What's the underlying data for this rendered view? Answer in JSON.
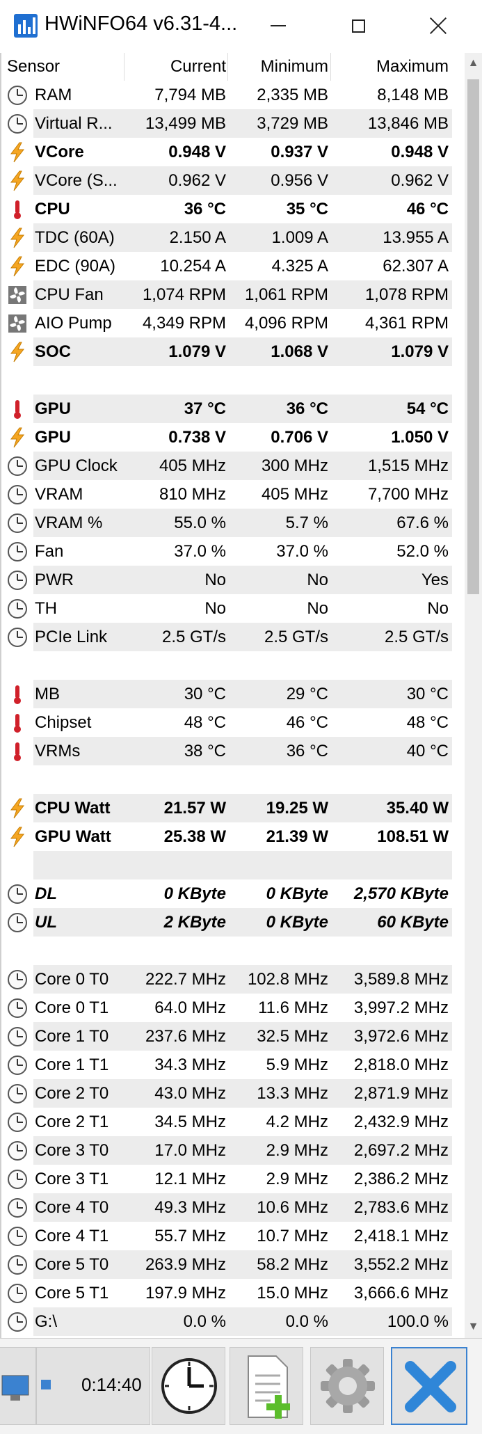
{
  "window": {
    "title": "HWiNFO64 v6.31-4..."
  },
  "table": {
    "columns": [
      "Sensor",
      "Current",
      "Minimum",
      "Maximum"
    ],
    "rows": [
      {
        "name": "RAM",
        "icon": "clock-icon",
        "style": "",
        "current": "7,794 MB",
        "minimum": "2,335 MB",
        "maximum": "8,148 MB"
      },
      {
        "name": "Virtual R...",
        "icon": "clock-icon",
        "style": "",
        "current": "13,499 MB",
        "minimum": "3,729 MB",
        "maximum": "13,846 MB"
      },
      {
        "name": "VCore",
        "icon": "lightning-icon",
        "style": "b",
        "current": "0.948 V",
        "minimum": "0.937 V",
        "maximum": "0.948 V"
      },
      {
        "name": "VCore (S...",
        "icon": "lightning-icon",
        "style": "",
        "current": "0.962 V",
        "minimum": "0.956 V",
        "maximum": "0.962 V"
      },
      {
        "name": "CPU",
        "icon": "thermometer-icon",
        "style": "b",
        "current": "36 °C",
        "minimum": "35 °C",
        "maximum": "46 °C"
      },
      {
        "name": "TDC (60A)",
        "icon": "lightning-icon",
        "style": "",
        "current": "2.150 A",
        "minimum": "1.009 A",
        "maximum": "13.955 A"
      },
      {
        "name": "EDC (90A)",
        "icon": "lightning-icon",
        "style": "",
        "current": "10.254 A",
        "minimum": "4.325 A",
        "maximum": "62.307 A"
      },
      {
        "name": "CPU Fan",
        "icon": "fan-icon",
        "style": "",
        "current": "1,074 RPM",
        "minimum": "1,061 RPM",
        "maximum": "1,078 RPM"
      },
      {
        "name": "AIO Pump",
        "icon": "fan-icon",
        "style": "",
        "current": "4,349 RPM",
        "minimum": "4,096 RPM",
        "maximum": "4,361 RPM"
      },
      {
        "name": "SOC",
        "icon": "lightning-icon",
        "style": "b",
        "current": "1.079 V",
        "minimum": "1.068 V",
        "maximum": "1.079 V"
      },
      {
        "name": "",
        "icon": "",
        "style": "",
        "current": "",
        "minimum": "",
        "maximum": ""
      },
      {
        "name": "GPU",
        "icon": "thermometer-icon",
        "style": "b",
        "current": "37 °C",
        "minimum": "36 °C",
        "maximum": "54 °C"
      },
      {
        "name": "GPU",
        "icon": "lightning-icon",
        "style": "b",
        "current": "0.738 V",
        "minimum": "0.706 V",
        "maximum": "1.050 V"
      },
      {
        "name": "GPU Clock",
        "icon": "clock-icon",
        "style": "",
        "current": "405 MHz",
        "minimum": "300 MHz",
        "maximum": "1,515 MHz"
      },
      {
        "name": "VRAM",
        "icon": "clock-icon",
        "style": "",
        "current": "810 MHz",
        "minimum": "405 MHz",
        "maximum": "7,700 MHz"
      },
      {
        "name": "VRAM %",
        "icon": "clock-icon",
        "style": "",
        "current": "55.0 %",
        "minimum": "5.7 %",
        "maximum": "67.6 %"
      },
      {
        "name": "Fan",
        "icon": "clock-icon",
        "style": "",
        "current": "37.0 %",
        "minimum": "37.0 %",
        "maximum": "52.0 %"
      },
      {
        "name": "PWR",
        "icon": "clock-icon",
        "style": "",
        "current": "No",
        "minimum": "No",
        "maximum": "Yes"
      },
      {
        "name": "TH",
        "icon": "clock-icon",
        "style": "",
        "current": "No",
        "minimum": "No",
        "maximum": "No"
      },
      {
        "name": "PCIe Link",
        "icon": "clock-icon",
        "style": "",
        "current": "2.5 GT/s",
        "minimum": "2.5 GT/s",
        "maximum": "2.5 GT/s"
      },
      {
        "name": "",
        "icon": "",
        "style": "",
        "current": "",
        "minimum": "",
        "maximum": ""
      },
      {
        "name": "MB",
        "icon": "thermometer-icon",
        "style": "",
        "current": "30 °C",
        "minimum": "29 °C",
        "maximum": "30 °C"
      },
      {
        "name": "Chipset",
        "icon": "thermometer-icon",
        "style": "",
        "current": "48 °C",
        "minimum": "46 °C",
        "maximum": "48 °C"
      },
      {
        "name": "VRMs",
        "icon": "thermometer-icon",
        "style": "",
        "current": "38 °C",
        "minimum": "36 °C",
        "maximum": "40 °C"
      },
      {
        "name": "",
        "icon": "",
        "style": "",
        "current": "",
        "minimum": "",
        "maximum": ""
      },
      {
        "name": "CPU Watt",
        "icon": "lightning-icon",
        "style": "b",
        "current": "21.57 W",
        "minimum": "19.25 W",
        "maximum": "35.40 W"
      },
      {
        "name": "GPU Watt",
        "icon": "lightning-icon",
        "style": "b",
        "current": "25.38 W",
        "minimum": "21.39 W",
        "maximum": "108.51 W"
      },
      {
        "name": "",
        "icon": "",
        "style": "",
        "current": "",
        "minimum": "",
        "maximum": ""
      },
      {
        "name": "DL",
        "icon": "clock-icon",
        "style": "bi",
        "current": "0 KByte",
        "minimum": "0 KByte",
        "maximum": "2,570 KByte"
      },
      {
        "name": "UL",
        "icon": "clock-icon",
        "style": "bi",
        "current": "2 KByte",
        "minimum": "0 KByte",
        "maximum": "60 KByte"
      },
      {
        "name": "",
        "icon": "",
        "style": "",
        "current": "",
        "minimum": "",
        "maximum": ""
      },
      {
        "name": "Core 0 T0",
        "icon": "clock-icon",
        "style": "",
        "current": "222.7 MHz",
        "minimum": "102.8 MHz",
        "maximum": "3,589.8 MHz"
      },
      {
        "name": "Core 0 T1",
        "icon": "clock-icon",
        "style": "",
        "current": "64.0 MHz",
        "minimum": "11.6 MHz",
        "maximum": "3,997.2 MHz"
      },
      {
        "name": "Core 1 T0",
        "icon": "clock-icon",
        "style": "",
        "current": "237.6 MHz",
        "minimum": "32.5 MHz",
        "maximum": "3,972.6 MHz"
      },
      {
        "name": "Core 1 T1",
        "icon": "clock-icon",
        "style": "",
        "current": "34.3 MHz",
        "minimum": "5.9 MHz",
        "maximum": "2,818.0 MHz"
      },
      {
        "name": "Core 2 T0",
        "icon": "clock-icon",
        "style": "",
        "current": "43.0 MHz",
        "minimum": "13.3 MHz",
        "maximum": "2,871.9 MHz"
      },
      {
        "name": "Core 2 T1",
        "icon": "clock-icon",
        "style": "",
        "current": "34.5 MHz",
        "minimum": "4.2 MHz",
        "maximum": "2,432.9 MHz"
      },
      {
        "name": "Core 3 T0",
        "icon": "clock-icon",
        "style": "",
        "current": "17.0 MHz",
        "minimum": "2.9 MHz",
        "maximum": "2,697.2 MHz"
      },
      {
        "name": "Core 3 T1",
        "icon": "clock-icon",
        "style": "",
        "current": "12.1 MHz",
        "minimum": "2.9 MHz",
        "maximum": "2,386.2 MHz"
      },
      {
        "name": "Core 4 T0",
        "icon": "clock-icon",
        "style": "",
        "current": "49.3 MHz",
        "minimum": "10.6 MHz",
        "maximum": "2,783.6 MHz"
      },
      {
        "name": "Core 4 T1",
        "icon": "clock-icon",
        "style": "",
        "current": "55.7 MHz",
        "minimum": "10.7 MHz",
        "maximum": "2,418.1 MHz"
      },
      {
        "name": "Core 5 T0",
        "icon": "clock-icon",
        "style": "",
        "current": "263.9 MHz",
        "minimum": "58.2 MHz",
        "maximum": "3,552.2 MHz"
      },
      {
        "name": "Core 5 T1",
        "icon": "clock-icon",
        "style": "",
        "current": "197.9 MHz",
        "minimum": "15.0 MHz",
        "maximum": "3,666.6 MHz"
      },
      {
        "name": "G:\\",
        "icon": "clock-icon",
        "style": "",
        "current": "0.0 %",
        "minimum": "0.0 %",
        "maximum": "100.0 %"
      }
    ]
  },
  "bottombar": {
    "timer": "0:14:40"
  },
  "colors": {
    "accent": "#1f6fd1",
    "lightning": "#f5a623",
    "thermometer": "#d0202a",
    "close_x": "#2f86d8"
  }
}
